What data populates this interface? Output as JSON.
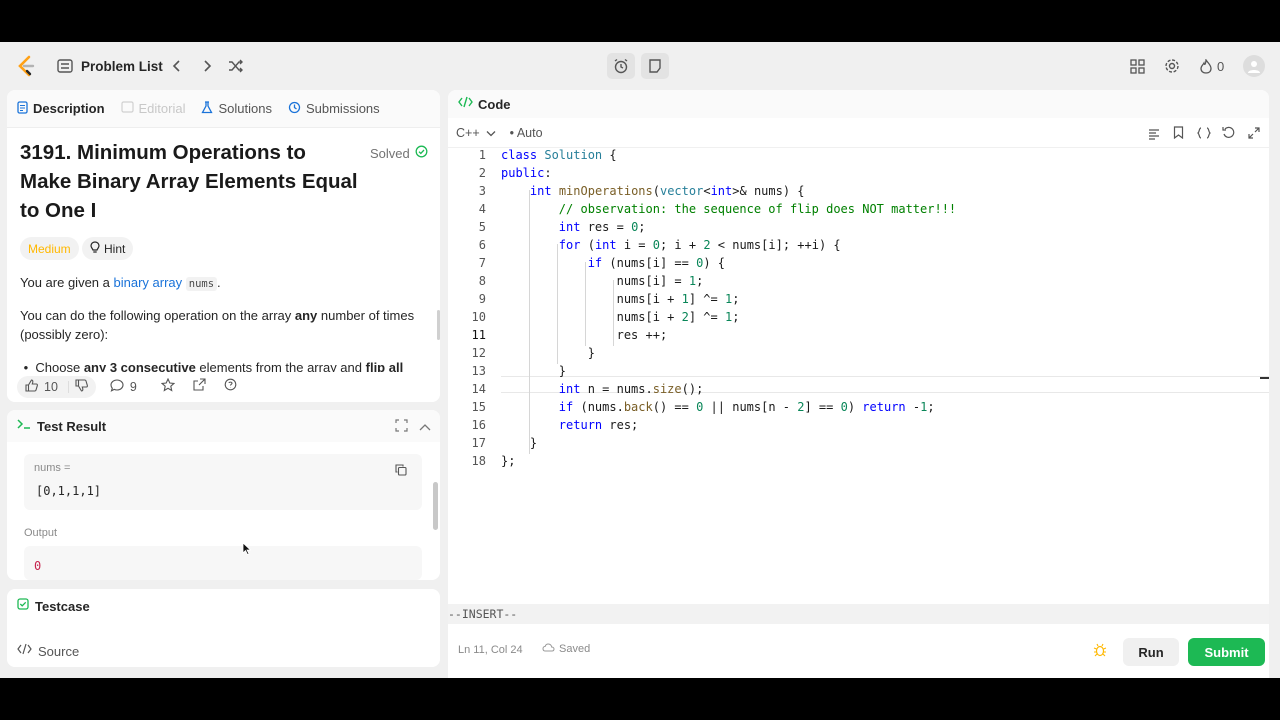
{
  "nav": {
    "problem_list": "Problem List",
    "streak_count": "0"
  },
  "description_tabs": [
    {
      "label": "Description"
    },
    {
      "label": "Editorial"
    },
    {
      "label": "Solutions"
    },
    {
      "label": "Submissions"
    }
  ],
  "problem": {
    "title": "3191. Minimum Operations to Make Binary Array Elements Equal to One I",
    "solved": "Solved",
    "difficulty": "Medium",
    "hint": "Hint",
    "p1_a": "You are given a ",
    "p1_link": "binary array",
    "p1_code": "nums",
    "p1_b": ".",
    "p2_a": "You can do the following operation on the array ",
    "p2_bold": "any",
    "p2_b": " number of times (possibly zero):",
    "bullet_a": "Choose ",
    "bullet_b": "any 3 consecutive",
    "bullet_c": " elements from the array and ",
    "bullet_d": "flip all"
  },
  "stats": {
    "likes": "10",
    "comments": "9"
  },
  "test_result": {
    "title": "Test Result",
    "input_label": "nums =",
    "input_value": "[0,1,1,1]",
    "output_label": "Output",
    "output_value": "0"
  },
  "testcase": {
    "title": "Testcase"
  },
  "source": {
    "label": "Source"
  },
  "code_panel": {
    "title": "Code",
    "language": "C++",
    "mode": "Auto",
    "vim_mode": "--INSERT--",
    "cursor_pos": "Ln 11, Col 24",
    "saved": "Saved",
    "run": "Run",
    "submit": "Submit",
    "lines": [
      "1",
      "2",
      "3",
      "4",
      "5",
      "6",
      "7",
      "8",
      "9",
      "10",
      "11",
      "12",
      "13",
      "14",
      "15",
      "16",
      "17",
      "18"
    ]
  },
  "colors": {
    "accent_green": "#1db954",
    "medium_orange": "#ffb800",
    "link_blue": "#1a73d9"
  }
}
